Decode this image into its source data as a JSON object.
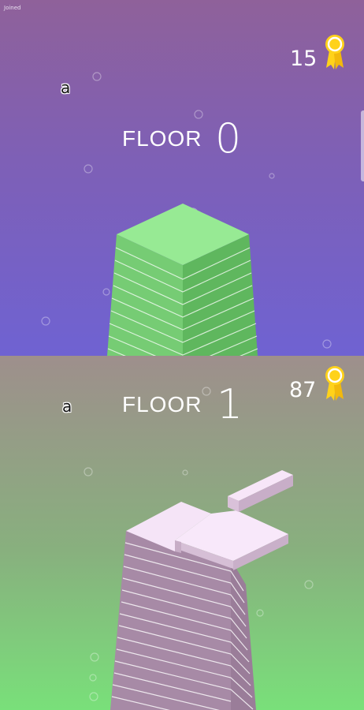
{
  "status_bar": {
    "text": "Joined"
  },
  "players": [
    {
      "label": "a",
      "floor_label": "FLOOR",
      "floor_value": "0",
      "best_score": "15",
      "medal_icon": "medal-ribbon-icon",
      "tower_color": "#8ee68c",
      "background": [
        "#8f619a",
        "#6f62d2"
      ]
    },
    {
      "label": "a",
      "floor_label": "FLOOR",
      "floor_value": "1",
      "best_score": "87",
      "medal_icon": "medal-ribbon-icon",
      "tower_color": "#f3e2f6",
      "background": [
        "#9e8f8c",
        "#79e07a"
      ]
    }
  ],
  "colors": {
    "medal_gold": "#ffd21a",
    "text": "#ffffff"
  }
}
